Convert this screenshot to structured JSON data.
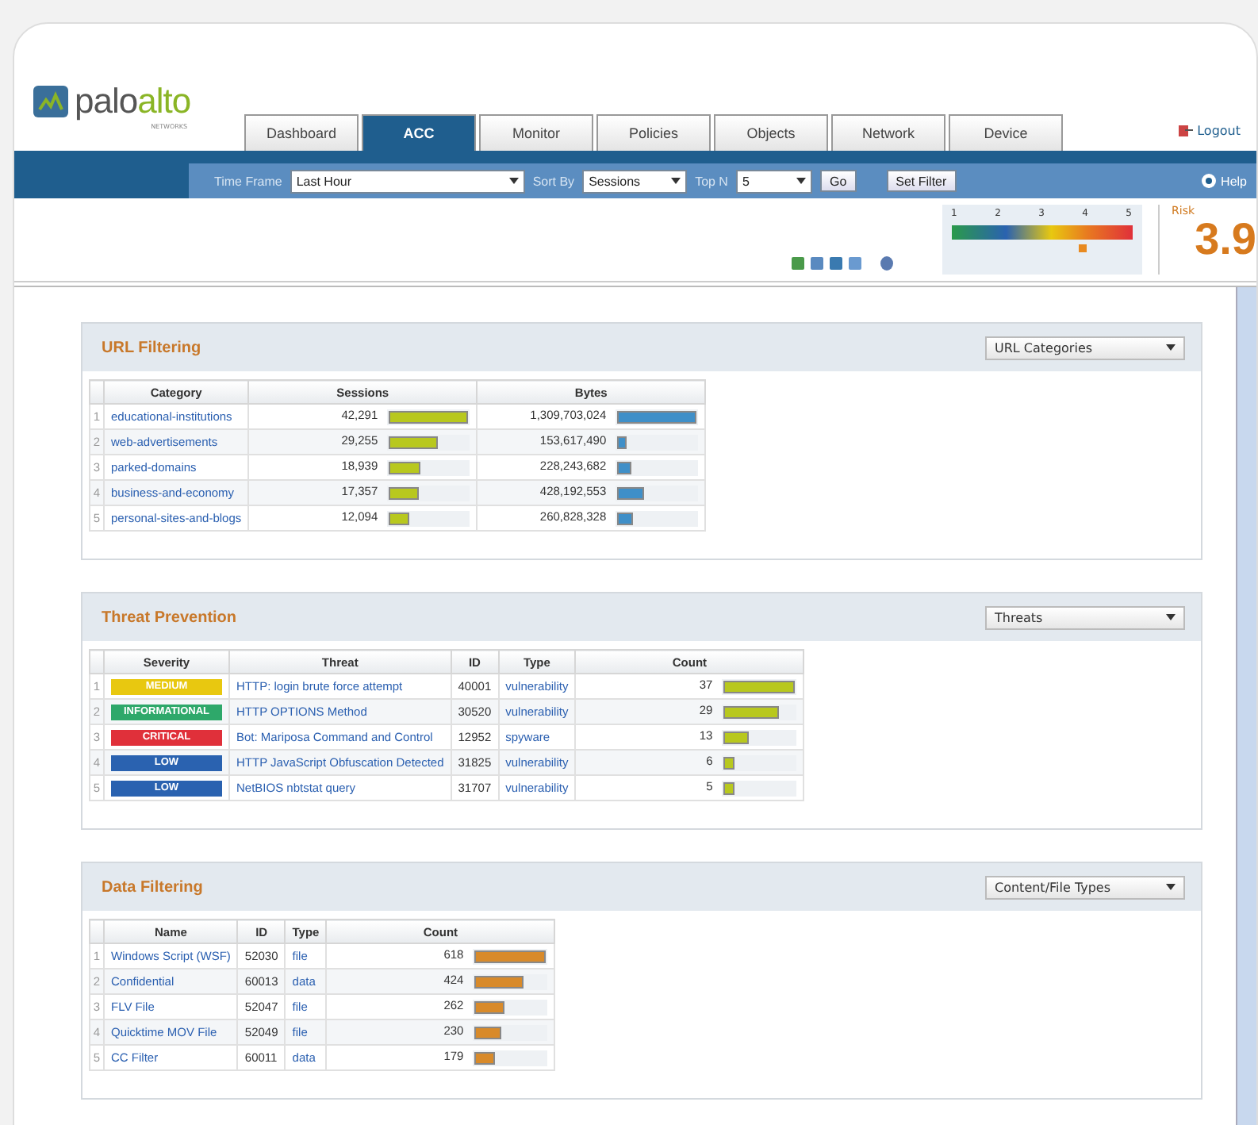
{
  "header": {
    "logo": {
      "brand_a": "palo",
      "brand_b": "alto",
      "sub": "NETWORKS"
    },
    "tabs": [
      {
        "label": "Dashboard",
        "selected": false
      },
      {
        "label": "ACC",
        "selected": true
      },
      {
        "label": "Monitor",
        "selected": false
      },
      {
        "label": "Policies",
        "selected": false
      },
      {
        "label": "Objects",
        "selected": false
      },
      {
        "label": "Network",
        "selected": false
      },
      {
        "label": "Device",
        "selected": false
      }
    ],
    "logout": "Logout"
  },
  "toolbar": {
    "time_frame": {
      "label": "Time Frame",
      "value": "Last Hour"
    },
    "sort_by": {
      "label": "Sort By",
      "value": "Sessions"
    },
    "top": {
      "label": "Top N",
      "value": "5"
    },
    "go": "Go",
    "set_filter": "Set Filter",
    "help": "Help"
  },
  "risk": {
    "ticks": [
      "1",
      "2",
      "3",
      "4",
      "5"
    ],
    "level": 0.72,
    "label": "Risk",
    "value": "3.9"
  },
  "panels": [
    {
      "title": "URL Filtering",
      "dropdown": "URL Categories",
      "columns": [
        {
          "label": "Category",
          "kind": "link"
        },
        {
          "label": "Sessions",
          "kind": "bar",
          "color": "#b8c81e"
        },
        {
          "label": "Bytes",
          "kind": "bar",
          "color": "#3f8fc8"
        }
      ],
      "rows": [
        {
          "index": "1",
          "cells": [
            {
              "text": "educational-institutions"
            },
            {
              "text": "42,291",
              "level": 1
            },
            {
              "text": "1,309,703,024",
              "level": 1
            }
          ]
        },
        {
          "index": "2",
          "cells": [
            {
              "text": "web-advertisements"
            },
            {
              "text": "29,255",
              "level": 0.62
            },
            {
              "text": "153,617,490",
              "level": 0.12
            }
          ]
        },
        {
          "index": "3",
          "cells": [
            {
              "text": "parked-domains"
            },
            {
              "text": "18,939",
              "level": 0.4
            },
            {
              "text": "228,243,682",
              "level": 0.17
            }
          ]
        },
        {
          "index": "4",
          "cells": [
            {
              "text": "business-and-economy"
            },
            {
              "text": "17,357",
              "level": 0.37
            },
            {
              "text": "428,192,553",
              "level": 0.33
            }
          ]
        },
        {
          "index": "5",
          "cells": [
            {
              "text": "personal-sites-and-blogs"
            },
            {
              "text": "12,094",
              "level": 0.26
            },
            {
              "text": "260,828,328",
              "level": 0.2
            }
          ]
        }
      ]
    },
    {
      "title": "Threat Prevention",
      "dropdown": "Threats",
      "columns": [
        {
          "label": "Severity",
          "kind": "severity"
        },
        {
          "label": "Threat",
          "kind": "link"
        },
        {
          "label": "ID",
          "kind": "plain"
        },
        {
          "label": "Type",
          "kind": "link"
        },
        {
          "label": "Count",
          "kind": "bar",
          "color": "#b8c81e"
        }
      ],
      "rows": [
        {
          "index": "1",
          "cells": [
            {
              "text": "MEDIUM",
              "color": "#e8c810"
            },
            {
              "text": "HTTP: login brute force attempt"
            },
            {
              "text": "40001"
            },
            {
              "text": "vulnerability"
            },
            {
              "text": "37",
              "level": 1
            }
          ]
        },
        {
          "index": "2",
          "cells": [
            {
              "text": "INFORMATIONAL",
              "color": "#2ea86a"
            },
            {
              "text": "HTTP OPTIONS Method"
            },
            {
              "text": "30520"
            },
            {
              "text": "vulnerability"
            },
            {
              "text": "29",
              "level": 0.78
            }
          ]
        },
        {
          "index": "3",
          "cells": [
            {
              "text": "CRITICAL",
              "color": "#e0303a"
            },
            {
              "text": "Bot: Mariposa Command and Control"
            },
            {
              "text": "12952"
            },
            {
              "text": "spyware"
            },
            {
              "text": "13",
              "level": 0.35
            }
          ]
        },
        {
          "index": "4",
          "cells": [
            {
              "text": "LOW",
              "color": "#2a62b0"
            },
            {
              "text": "HTTP JavaScript Obfuscation Detected"
            },
            {
              "text": "31825"
            },
            {
              "text": "vulnerability"
            },
            {
              "text": "6",
              "level": 0.16
            }
          ]
        },
        {
          "index": "5",
          "cells": [
            {
              "text": "LOW",
              "color": "#2a62b0"
            },
            {
              "text": "NetBIOS nbtstat query"
            },
            {
              "text": "31707"
            },
            {
              "text": "vulnerability"
            },
            {
              "text": "5",
              "level": 0.14
            }
          ]
        }
      ]
    },
    {
      "title": "Data Filtering",
      "dropdown": "Content/File Types",
      "columns": [
        {
          "label": "Name",
          "kind": "link"
        },
        {
          "label": "ID",
          "kind": "plain"
        },
        {
          "label": "Type",
          "kind": "link"
        },
        {
          "label": "Count",
          "kind": "bar",
          "color": "#d88a2a"
        }
      ],
      "rows": [
        {
          "index": "1",
          "cells": [
            {
              "text": "Windows Script (WSF)"
            },
            {
              "text": "52030"
            },
            {
              "text": "file"
            },
            {
              "text": "618",
              "level": 1
            }
          ]
        },
        {
          "index": "2",
          "cells": [
            {
              "text": "Confidential"
            },
            {
              "text": "60013"
            },
            {
              "text": "data"
            },
            {
              "text": "424",
              "level": 0.69
            }
          ]
        },
        {
          "index": "3",
          "cells": [
            {
              "text": "FLV File"
            },
            {
              "text": "52047"
            },
            {
              "text": "file"
            },
            {
              "text": "262",
              "level": 0.42
            }
          ]
        },
        {
          "index": "4",
          "cells": [
            {
              "text": "Quicktime MOV File"
            },
            {
              "text": "52049"
            },
            {
              "text": "file"
            },
            {
              "text": "230",
              "level": 0.37
            }
          ]
        },
        {
          "index": "5",
          "cells": [
            {
              "text": "CC Filter"
            },
            {
              "text": "60011"
            },
            {
              "text": "data"
            },
            {
              "text": "179",
              "level": 0.29
            }
          ]
        }
      ]
    }
  ]
}
